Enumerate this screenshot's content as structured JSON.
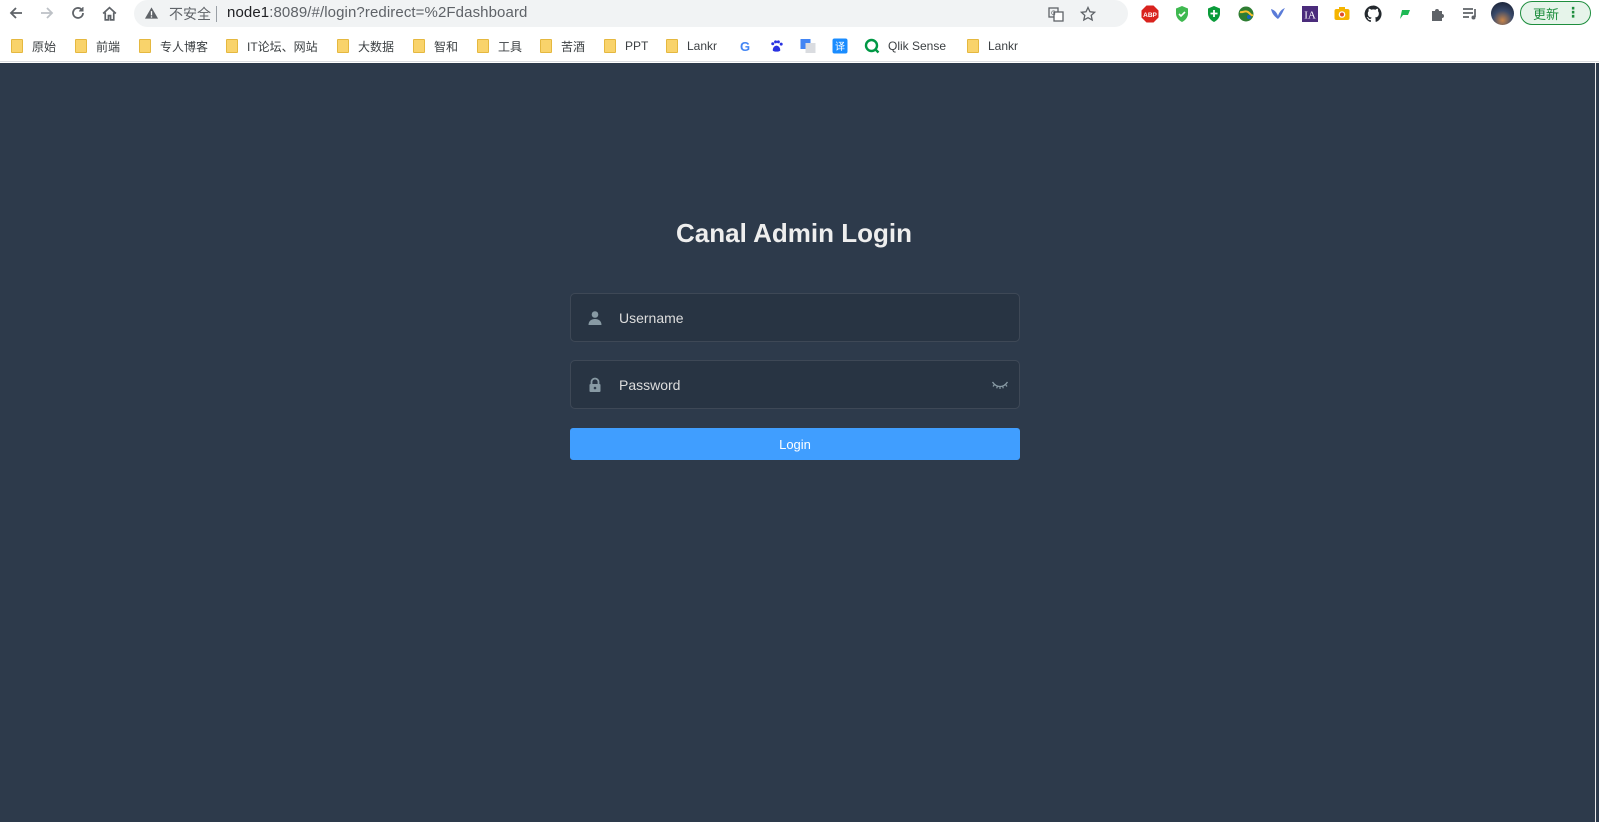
{
  "browser": {
    "address_bar": {
      "security_label": "不安全",
      "url_host": "node1",
      "url_rest": ":8089/#/login?redirect=%2Fdashboard"
    },
    "extensions": [
      "translate-icon",
      "bookmark-star-icon",
      "adblock-icon",
      "shield-check-icon",
      "shield-plus-icon",
      "globe-icon",
      "bird-icon",
      "ia-icon",
      "camera-icon",
      "github-icon",
      "flag-icon",
      "puzzle-icon",
      "playlist-icon"
    ],
    "adblock_label": "ABP",
    "ia_label": "IA",
    "update_button": "更新",
    "update_menu": "⋮"
  },
  "bookmarks": [
    {
      "label": "原始",
      "icon": "folder"
    },
    {
      "label": "前端",
      "icon": "folder"
    },
    {
      "label": "专人博客",
      "icon": "folder"
    },
    {
      "label": "IT论坛、网站",
      "icon": "folder"
    },
    {
      "label": "大数据",
      "icon": "folder"
    },
    {
      "label": "智和",
      "icon": "folder"
    },
    {
      "label": "工具",
      "icon": "folder"
    },
    {
      "label": "苦酒",
      "icon": "folder"
    },
    {
      "label": "PPT",
      "icon": "folder"
    },
    {
      "label": "Lankr",
      "icon": "folder"
    },
    {
      "label": "",
      "icon": "google-icon"
    },
    {
      "label": "",
      "icon": "baidu-icon"
    },
    {
      "label": "",
      "icon": "google-translate-icon"
    },
    {
      "label": "",
      "icon": "youdao-translate-icon"
    },
    {
      "label": "Qlik Sense",
      "icon": "qlik-icon"
    },
    {
      "label": "Lankr",
      "icon": "folder"
    }
  ],
  "bookmark_glyphs": {
    "google": "G",
    "translate": "译"
  },
  "login": {
    "title": "Canal Admin Login",
    "username_placeholder": "Username",
    "username_value": "",
    "password_placeholder": "Password",
    "password_value": "",
    "login_button": "Login"
  },
  "colors": {
    "page_background": "#2d3a4b",
    "button_primary": "#409eff",
    "title_text": "#eeeeee"
  }
}
